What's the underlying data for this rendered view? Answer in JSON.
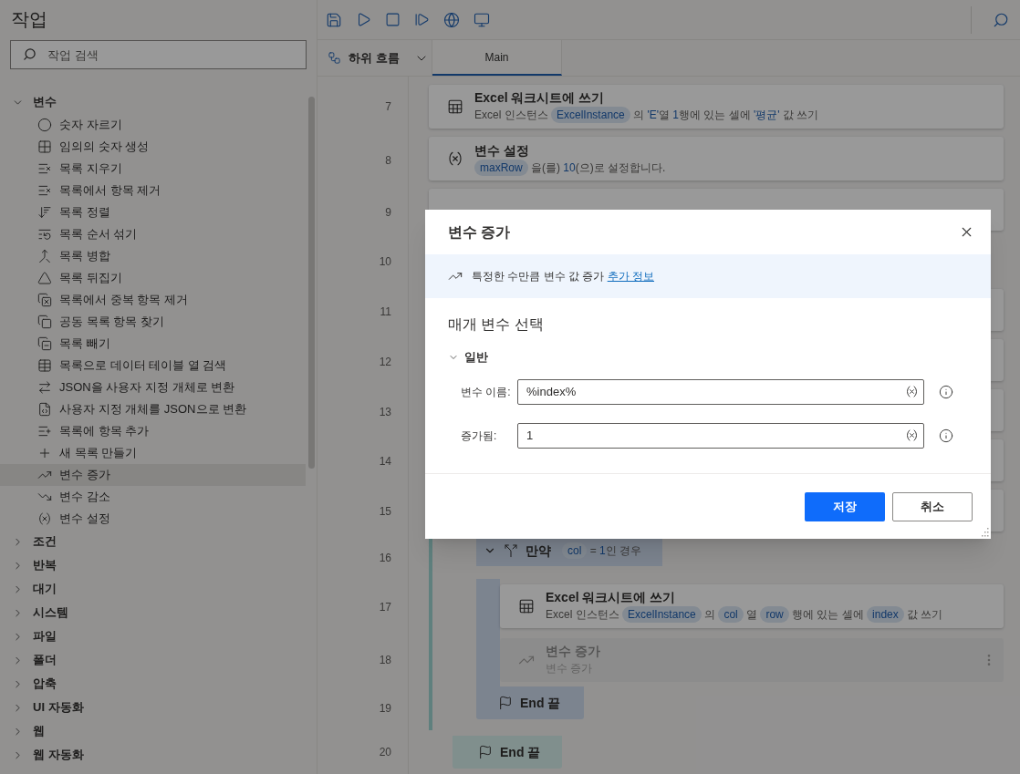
{
  "sidebar": {
    "title": "작업",
    "search": {
      "placeholder": "작업 검색"
    },
    "categories": [
      {
        "label": "변수",
        "expanded": true,
        "items": [
          {
            "label": "숫자 자르기",
            "selected": false
          },
          {
            "label": "임의의 숫자 생성",
            "selected": false
          },
          {
            "label": "목록 지우기",
            "selected": false
          },
          {
            "label": "목록에서 항목 제거",
            "selected": false
          },
          {
            "label": "목록 정렬",
            "selected": false
          },
          {
            "label": "목록 순서 섞기",
            "selected": false
          },
          {
            "label": "목록 병합",
            "selected": false
          },
          {
            "label": "목록 뒤집기",
            "selected": false
          },
          {
            "label": "목록에서 중복 항목 제거",
            "selected": false
          },
          {
            "label": "공동 목록 항목 찾기",
            "selected": false
          },
          {
            "label": "목록 빼기",
            "selected": false
          },
          {
            "label": "목록으로 데이터 테이블 열 검색",
            "selected": false
          },
          {
            "label": "JSON을 사용자 지정 개체로 변환",
            "selected": false
          },
          {
            "label": "사용자 지정 개체를 JSON으로 변환",
            "selected": false
          },
          {
            "label": "목록에 항목 추가",
            "selected": false
          },
          {
            "label": "새 목록 만들기",
            "selected": false
          },
          {
            "label": "변수 증가",
            "selected": true
          },
          {
            "label": "변수 감소",
            "selected": false
          },
          {
            "label": "변수 설정",
            "selected": false
          }
        ]
      },
      {
        "label": "조건",
        "expanded": false
      },
      {
        "label": "반복",
        "expanded": false
      },
      {
        "label": "대기",
        "expanded": false
      },
      {
        "label": "시스템",
        "expanded": false
      },
      {
        "label": "파일",
        "expanded": false
      },
      {
        "label": "폴더",
        "expanded": false
      },
      {
        "label": "압축",
        "expanded": false
      },
      {
        "label": "UI 자동화",
        "expanded": false
      },
      {
        "label": "웹",
        "expanded": false
      },
      {
        "label": "웹 자동화",
        "expanded": false
      }
    ]
  },
  "subflows": {
    "label": "하위 흐름",
    "tabs": [
      {
        "label": "Main",
        "selected": true
      }
    ]
  },
  "flow": [
    {
      "line": "7",
      "kind": "write",
      "title": "Excel 워크시트에 쓰기",
      "disabled": false,
      "parts": [
        {
          "kind": "plain",
          "text": "Excel 인스턴스 "
        },
        {
          "kind": "var",
          "text": "ExcelInstance"
        },
        {
          "kind": "plain",
          "text": " 의 "
        },
        {
          "kind": "value",
          "text": "'E'"
        },
        {
          "kind": "plain",
          "text": "열 "
        },
        {
          "kind": "value",
          "text": "1"
        },
        {
          "kind": "plain",
          "text": "행에 있는 셀에 "
        },
        {
          "kind": "value",
          "text": "'평균'"
        },
        {
          "kind": "plain",
          "text": " 값 쓰기"
        }
      ]
    },
    {
      "line": "8",
      "kind": "assign",
      "title": "변수 설정",
      "disabled": false,
      "parts": [
        {
          "kind": "var",
          "text": "maxRow"
        },
        {
          "kind": "plain",
          "text": " 을(를) "
        },
        {
          "kind": "value",
          "text": "10"
        },
        {
          "kind": "plain",
          "text": "(으)로 설정합니다."
        }
      ]
    },
    {
      "line": "9",
      "kind": "hidden"
    },
    {
      "line": "10",
      "kind": "loop",
      "children": [
        {
          "line": "11",
          "kind": "hidden"
        },
        {
          "line": "12",
          "kind": "hidden"
        },
        {
          "line": "13",
          "kind": "hidden"
        },
        {
          "line": "14",
          "kind": "hidden"
        },
        {
          "line": "15",
          "kind": "hidden"
        },
        {
          "line": "16",
          "kind": "if",
          "title": "만약",
          "expanded": true,
          "parts": [
            {
              "kind": "var",
              "text": "col"
            },
            {
              "kind": "plain",
              "text": " = "
            },
            {
              "kind": "value",
              "text": "1"
            },
            {
              "kind": "plain",
              "text": "인 경우"
            }
          ],
          "children": [
            {
              "line": "17",
              "kind": "write",
              "title": "Excel 워크시트에 쓰기",
              "disabled": false,
              "parts": [
                {
                  "kind": "plain",
                  "text": "Excel 인스턴스 "
                },
                {
                  "kind": "var",
                  "text": "ExcelInstance"
                },
                {
                  "kind": "plain",
                  "text": " 의 "
                },
                {
                  "kind": "var",
                  "text": "col"
                },
                {
                  "kind": "plain",
                  "text": " 열 "
                },
                {
                  "kind": "var",
                  "text": "row"
                },
                {
                  "kind": "plain",
                  "text": " 행에 있는 셀에 "
                },
                {
                  "kind": "var",
                  "text": "index"
                },
                {
                  "kind": "plain",
                  "text": " 값 쓰기"
                }
              ]
            },
            {
              "line": "18",
              "kind": "increment",
              "title": "변수 증가",
              "disabled": true,
              "parts": [
                {
                  "kind": "plain",
                  "text": "변수 증가"
                }
              ]
            }
          ],
          "end": {
            "line": "19",
            "label": "End 끝"
          }
        }
      ],
      "end": {
        "line": "20",
        "label": "End 끝"
      }
    }
  ],
  "dialog": {
    "title": "변수 증가",
    "info": {
      "text": "특정한 수만큼 변수 값 증가",
      "link": "추가 정보"
    },
    "section_title": "매개 변수 선택",
    "group": {
      "label": "일반",
      "expanded": true
    },
    "fields": [
      {
        "label": "변수 이름:",
        "value": "%index%"
      },
      {
        "label": "증가됨:",
        "value": "1"
      }
    ],
    "buttons": [
      {
        "label": "저장",
        "kind": "primary"
      },
      {
        "label": "취소",
        "kind": "secondary"
      }
    ]
  }
}
